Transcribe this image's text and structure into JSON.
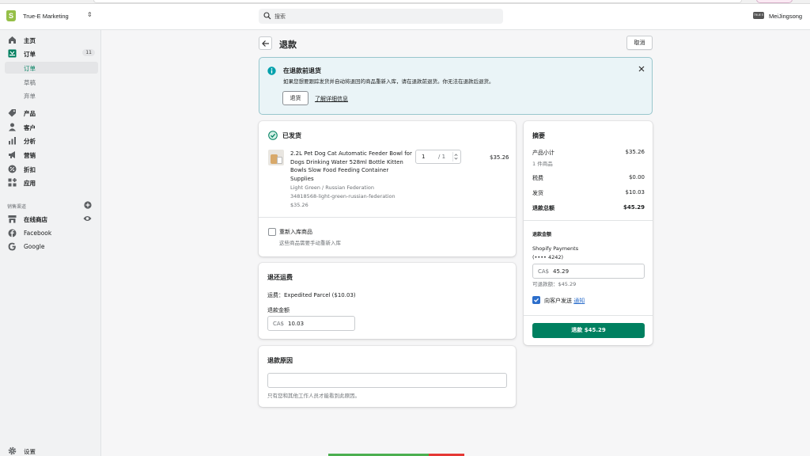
{
  "topbar": {
    "store_name": "True-E Marketing",
    "search_placeholder": "搜索",
    "user_name": "MeiJingsong",
    "avatar_text": "TRUE E"
  },
  "sidebar": {
    "items": [
      {
        "label": "主页",
        "icon": "home-icon"
      },
      {
        "label": "订单",
        "icon": "orders-icon",
        "badge": "11"
      },
      {
        "label": "订单",
        "sub": true,
        "active": true
      },
      {
        "label": "草稿",
        "sub": true
      },
      {
        "label": "弃单",
        "sub": true
      },
      {
        "label": "产品",
        "icon": "tag-icon"
      },
      {
        "label": "客户",
        "icon": "person-icon"
      },
      {
        "label": "分析",
        "icon": "bar-chart-icon"
      },
      {
        "label": "营销",
        "icon": "megaphone-icon"
      },
      {
        "label": "折扣",
        "icon": "discount-icon"
      },
      {
        "label": "应用",
        "icon": "apps-icon"
      }
    ],
    "channels_heading": "销售渠道",
    "channels": [
      {
        "label": "在线商店",
        "icon": "store-icon"
      },
      {
        "label": "Facebook",
        "icon": "facebook-icon"
      },
      {
        "label": "Google",
        "icon": "google-icon"
      }
    ],
    "settings_label": "设置"
  },
  "page": {
    "title": "退款",
    "cancel_label": "取消"
  },
  "banner": {
    "title": "在退款前退货",
    "description": "如果您想要跟踪发货并自动将退回的商品重新入库，请在退款前退货。你无法在退款后退货。",
    "return_button": "退货",
    "learn_more": "了解详细信息"
  },
  "fulfilled": {
    "status": "已发货",
    "product_name": "2.2L Pet Dog Cat Automatic Feeder Bowl for Dogs Drinking Water 528ml Bottle Kitten Bowls Slow Food Feeding Container Supplies",
    "variant": "Light Green / Russian Federation",
    "sku": "34818568-light-green-russian-federation",
    "unit_price": "$35.26",
    "qty_value": "1",
    "qty_total": "/ 1",
    "line_total": "$35.26",
    "restock_label": "重新入库商品",
    "restock_hint": "这些商品需要手动重新入库"
  },
  "shipping": {
    "title": "退还运费",
    "desc": "运费：Expedited Parcel ($10.03)",
    "amount_label": "退款金额",
    "currency": "CA$",
    "amount_value": "10.03"
  },
  "reason": {
    "title": "退款原因",
    "hint": "只有您和其他工作人员才能看到此原因。"
  },
  "summary": {
    "title": "摘要",
    "subtotal_label": "产品小计",
    "subtotal_value": "$35.26",
    "item_count": "1 件商品",
    "tax_label": "税费",
    "tax_value": "$0.00",
    "shipping_label": "发货",
    "shipping_value": "$10.03",
    "total_label": "退款总额",
    "total_value": "$45.29",
    "refund_amount_heading": "退款金额",
    "payment_method": "Shopify Payments",
    "card_digits": "(•••• 4242)",
    "currency": "CA$",
    "refund_value": "45.29",
    "available": "可退款额：$45.29",
    "notify_prefix": "向客户发送",
    "notify_link": "通知",
    "refund_button": "退款 $45.29"
  },
  "colors": {
    "primary": "#008060",
    "banner_bg": "#eaf4f7",
    "checkbox_blue": "#2c6ecb"
  }
}
